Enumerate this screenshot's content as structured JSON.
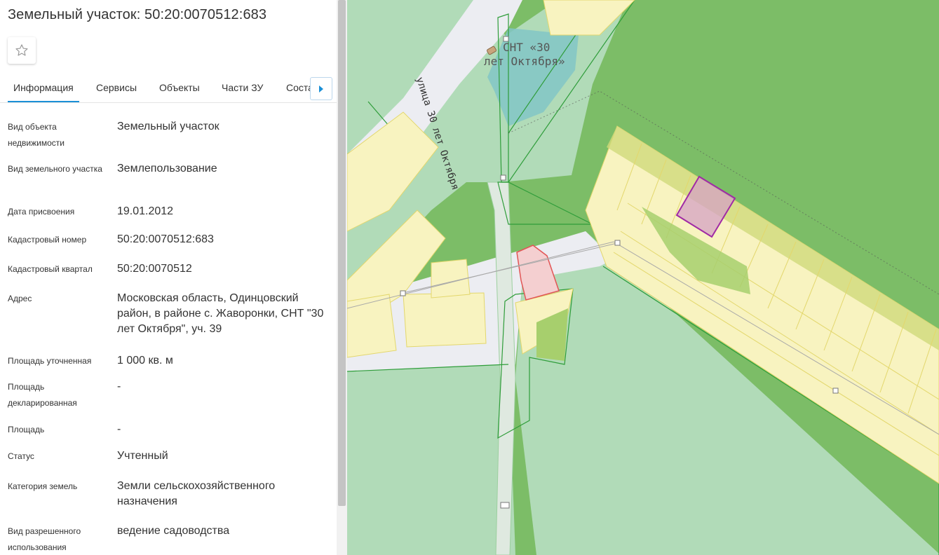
{
  "panel": {
    "title": "Земельный участок: 50:20:0070512:683",
    "favorite_icon": "star-outline-icon",
    "tabs": [
      {
        "label": "Информация",
        "active": true
      },
      {
        "label": "Сервисы"
      },
      {
        "label": "Объекты"
      },
      {
        "label": "Части ЗУ"
      },
      {
        "label": "Соста"
      }
    ],
    "tab_next_icon": "caret-right-icon",
    "info": [
      {
        "label": "Вид объекта недвижимости",
        "value": "Земельный участок"
      },
      {
        "label": "Вид земельного участка",
        "value": "Землепользование"
      },
      {
        "label": "Дата присвоения",
        "value": "19.01.2012"
      },
      {
        "label": "Кадастровый номер",
        "value": "50:20:0070512:683"
      },
      {
        "label": "Кадастровый квартал",
        "value": "50:20:0070512"
      },
      {
        "label": "Адрес",
        "value": "Московская область, Одинцовский район, в районе с. Жаворонки, СНТ \"30 лет Октября\", уч. 39"
      },
      {
        "label": "Площадь уточненная",
        "value": "1 000 кв. м"
      },
      {
        "label": "Площадь декларированная",
        "value": "-"
      },
      {
        "label": "Площадь",
        "value": "-"
      },
      {
        "label": "Статус",
        "value": "Учтенный"
      },
      {
        "label": "Категория земель",
        "value": "Земли сельскохозяйственного назначения"
      },
      {
        "label": "Вид разрешенного использования",
        "value": "ведение садоводства"
      }
    ]
  },
  "map": {
    "street_label": "улица 30 лет Октября",
    "snt_label_line1": "СНТ «30",
    "snt_label_line2": "лет Октября»",
    "colors": {
      "forest": "#7cbd67",
      "light_green": "#b1dbb8",
      "parcel_fill": "#f8f3c0",
      "parcel_stroke": "#e3d76c",
      "water": "#82c5c5",
      "selected_outline": "#a02aa5",
      "red_parcel": "#e25555",
      "background": "#ecedf2"
    }
  }
}
